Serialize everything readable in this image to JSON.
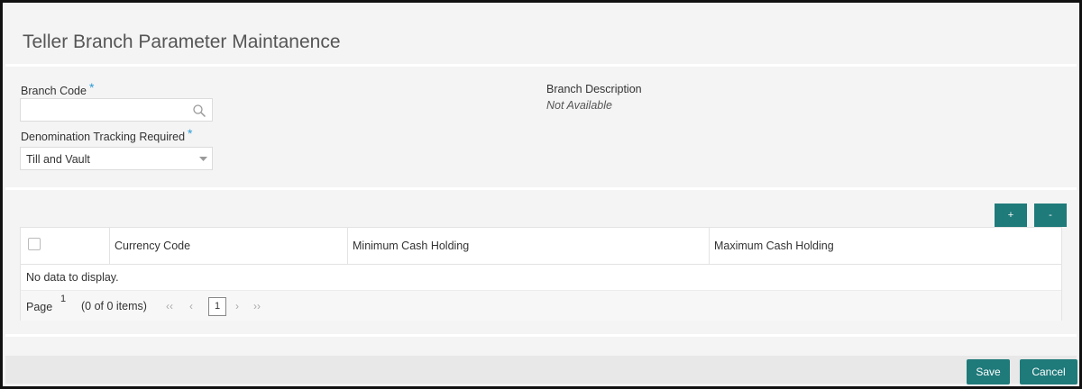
{
  "page": {
    "title": "Teller Branch Parameter Maintanence"
  },
  "form": {
    "branch_code": {
      "label": "Branch Code",
      "required_mark": "*",
      "value": ""
    },
    "branch_description": {
      "label": "Branch Description",
      "value": "Not Available"
    },
    "denomination_tracking": {
      "label": "Denomination Tracking Required",
      "required_mark": "*",
      "value": "Till and Vault"
    }
  },
  "grid": {
    "add_label": "+",
    "remove_label": "-",
    "columns": [
      "Currency Code",
      "Minimum Cash Holding",
      "Maximum Cash Holding"
    ],
    "rows": [],
    "empty_message": "No data to display.",
    "pager": {
      "page_label": "Page",
      "current_page": "1",
      "items_summary": "(0 of 0 items)",
      "page_box": "1",
      "first_icon": "first-page-icon",
      "prev_icon": "prev-page-icon",
      "next_icon": "next-page-icon",
      "last_icon": "last-page-icon"
    }
  },
  "footer": {
    "save_label": "Save",
    "cancel_label": "Cancel"
  },
  "colors": {
    "accent": "#1f7a7a",
    "required": "#2d9bd6",
    "background": "#f4f4f4"
  }
}
